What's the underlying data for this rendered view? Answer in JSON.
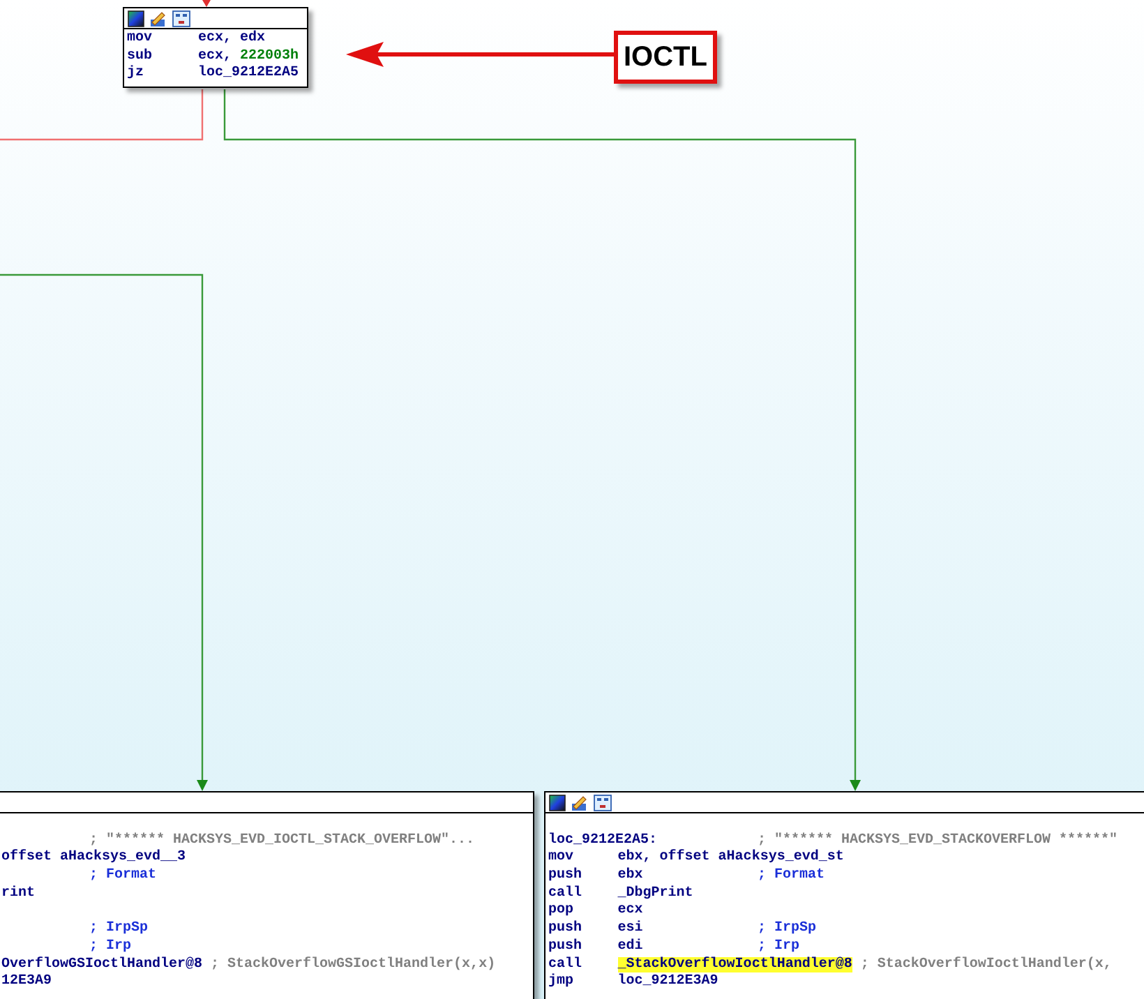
{
  "graph": {
    "nodes": [
      {
        "header_icons": true,
        "lines": [
          {
            "kind": "code",
            "mnemonic": "mov",
            "operands": "ecx, edx"
          },
          {
            "kind": "code",
            "mnemonic": "sub",
            "operands": "ecx,",
            "immediate": "222003h"
          },
          {
            "kind": "code",
            "mnemonic": "jz",
            "operands": "loc_9212E2A5"
          }
        ]
      },
      {
        "header_icons": false,
        "lines": [
          {
            "kind": "blank"
          },
          {
            "kind": "code",
            "comment": "; \"****** HACKSYS_EVD_IOCTL_STACK_OVERFLOW\"...",
            "string_comment": true
          },
          {
            "kind": "code",
            "operands": "offset aHacksys_evd__3"
          },
          {
            "kind": "code",
            "comment": "; Format",
            "string_comment": false
          },
          {
            "kind": "code",
            "operands": "rint"
          },
          {
            "kind": "blank"
          },
          {
            "kind": "code",
            "comment": "; IrpSp",
            "string_comment": false
          },
          {
            "kind": "code",
            "comment": "; Irp",
            "string_comment": false
          },
          {
            "kind": "code",
            "operands": "OverflowGSIoctlHandler@8",
            "comment": "; StackOverflowGSIoctlHandler(x,x)",
            "string_comment": true
          },
          {
            "kind": "code",
            "operands": "12E3A9"
          }
        ]
      },
      {
        "header_icons": true,
        "lines": [
          {
            "kind": "blank"
          },
          {
            "kind": "label",
            "label": "loc_9212E2A5:",
            "comment": "; \"****** HACKSYS_EVD_STACKOVERFLOW ******\"",
            "string_comment": true
          },
          {
            "kind": "code",
            "mnemonic": "mov",
            "operands": "ebx, offset aHacksys_evd_st"
          },
          {
            "kind": "code",
            "mnemonic": "push",
            "operands": "ebx",
            "comment": "; Format",
            "string_comment": false
          },
          {
            "kind": "code",
            "mnemonic": "call",
            "operands": "_DbgPrint"
          },
          {
            "kind": "code",
            "mnemonic": "pop",
            "operands": "ecx"
          },
          {
            "kind": "code",
            "mnemonic": "push",
            "operands": "esi",
            "comment": "; IrpSp",
            "string_comment": false
          },
          {
            "kind": "code",
            "mnemonic": "push",
            "operands": "edi",
            "comment": "; Irp",
            "string_comment": false
          },
          {
            "kind": "code",
            "mnemonic": "call",
            "operands": "_StackOverflowIoctlHandler@8",
            "highlight": true,
            "comment": "; StackOverflowIoctlHandler(x,",
            "string_comment": true
          },
          {
            "kind": "code",
            "mnemonic": "jmp",
            "operands": "loc_9212E3A9"
          }
        ]
      }
    ]
  },
  "annotation": {
    "label": "IOCTL"
  }
}
